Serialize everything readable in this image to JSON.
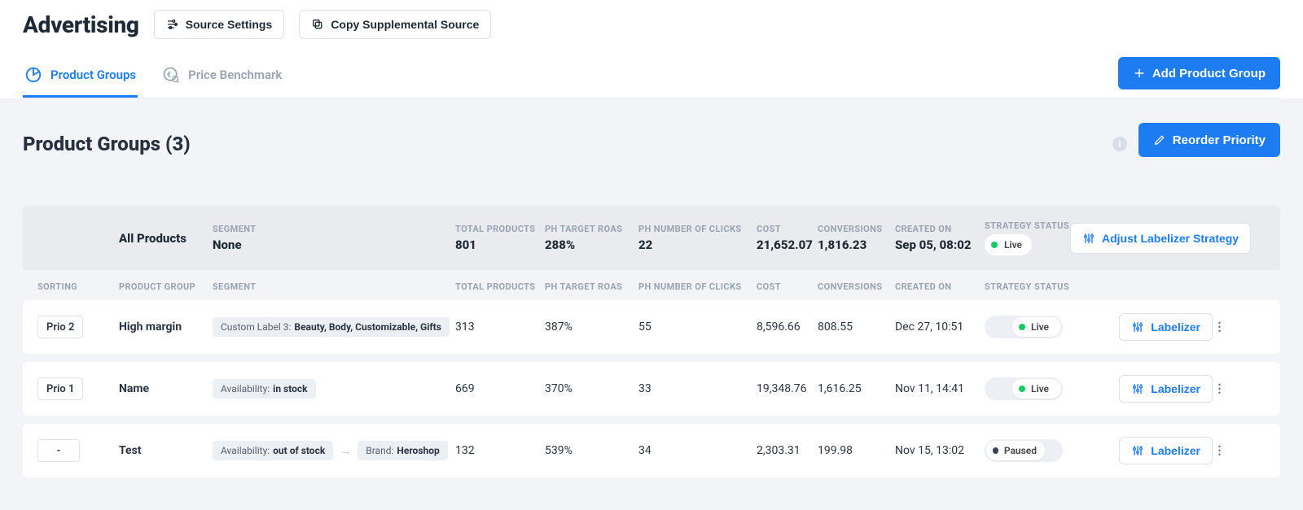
{
  "header": {
    "title": "Advertising",
    "source_settings": "Source Settings",
    "copy_supplemental": "Copy Supplemental Source"
  },
  "tabs": {
    "product_groups": "Product Groups",
    "price_benchmark": "Price Benchmark"
  },
  "add_button": "Add Product Group",
  "section": {
    "title": "Product Groups (3)",
    "reorder": "Reorder Priority"
  },
  "summary": {
    "all_products": "All Products",
    "segment_label": "SEGMENT",
    "segment_value": "None",
    "total_products_label": "TOTAL PRODUCTS",
    "total_products_value": "801",
    "target_roas_label": "PH TARGET ROAS",
    "target_roas_value": "288%",
    "clicks_label": "PH NUMBER OF CLICKS",
    "clicks_value": "22",
    "cost_label": "COST",
    "cost_value": "21,652.07",
    "conversions_label": "CONVERSIONS",
    "conversions_value": "1,816.23",
    "created_label": "CREATED ON",
    "created_value": "Sep 05, 08:02",
    "status_label": "STRATEGY STATUS",
    "status_value": "Live",
    "adjust_button": "Adjust Labelizer Strategy"
  },
  "columns": {
    "sorting": "SORTING",
    "product_group": "PRODUCT GROUP",
    "segment": "SEGMENT",
    "total_products": "TOTAL PRODUCTS",
    "target_roas": "PH TARGET ROAS",
    "clicks": "PH NUMBER OF CLICKS",
    "cost": "COST",
    "conversions": "CONVERSIONS",
    "created": "CREATED ON",
    "status": "STRATEGY STATUS"
  },
  "labelizer_btn": "Labelizer",
  "rows": [
    {
      "prio": "Prio 2",
      "name": "High margin",
      "seg1_key": "Custom Label 3:",
      "seg1_val": "Beauty, Body, Customizable, Gifts",
      "seg2_key": "",
      "seg2_val": "",
      "total": "313",
      "roas": "387%",
      "clicks": "55",
      "cost": "8,596.66",
      "conv": "808.55",
      "created": "Dec 27, 10:51",
      "status": "Live",
      "live": true
    },
    {
      "prio": "Prio 1",
      "name": "Name",
      "seg1_key": "Availability:",
      "seg1_val": "in stock",
      "seg2_key": "",
      "seg2_val": "",
      "total": "669",
      "roas": "370%",
      "clicks": "33",
      "cost": "19,348.76",
      "conv": "1,616.25",
      "created": "Nov 11, 14:41",
      "status": "Live",
      "live": true
    },
    {
      "prio": "-",
      "name": "Test",
      "seg1_key": "Availability:",
      "seg1_val": "out of stock",
      "seg2_key": "Brand:",
      "seg2_val": "Heroshop",
      "total": "132",
      "roas": "539%",
      "clicks": "34",
      "cost": "2,303.31",
      "conv": "199.98",
      "created": "Nov 15, 13:02",
      "status": "Paused",
      "live": false
    }
  ]
}
